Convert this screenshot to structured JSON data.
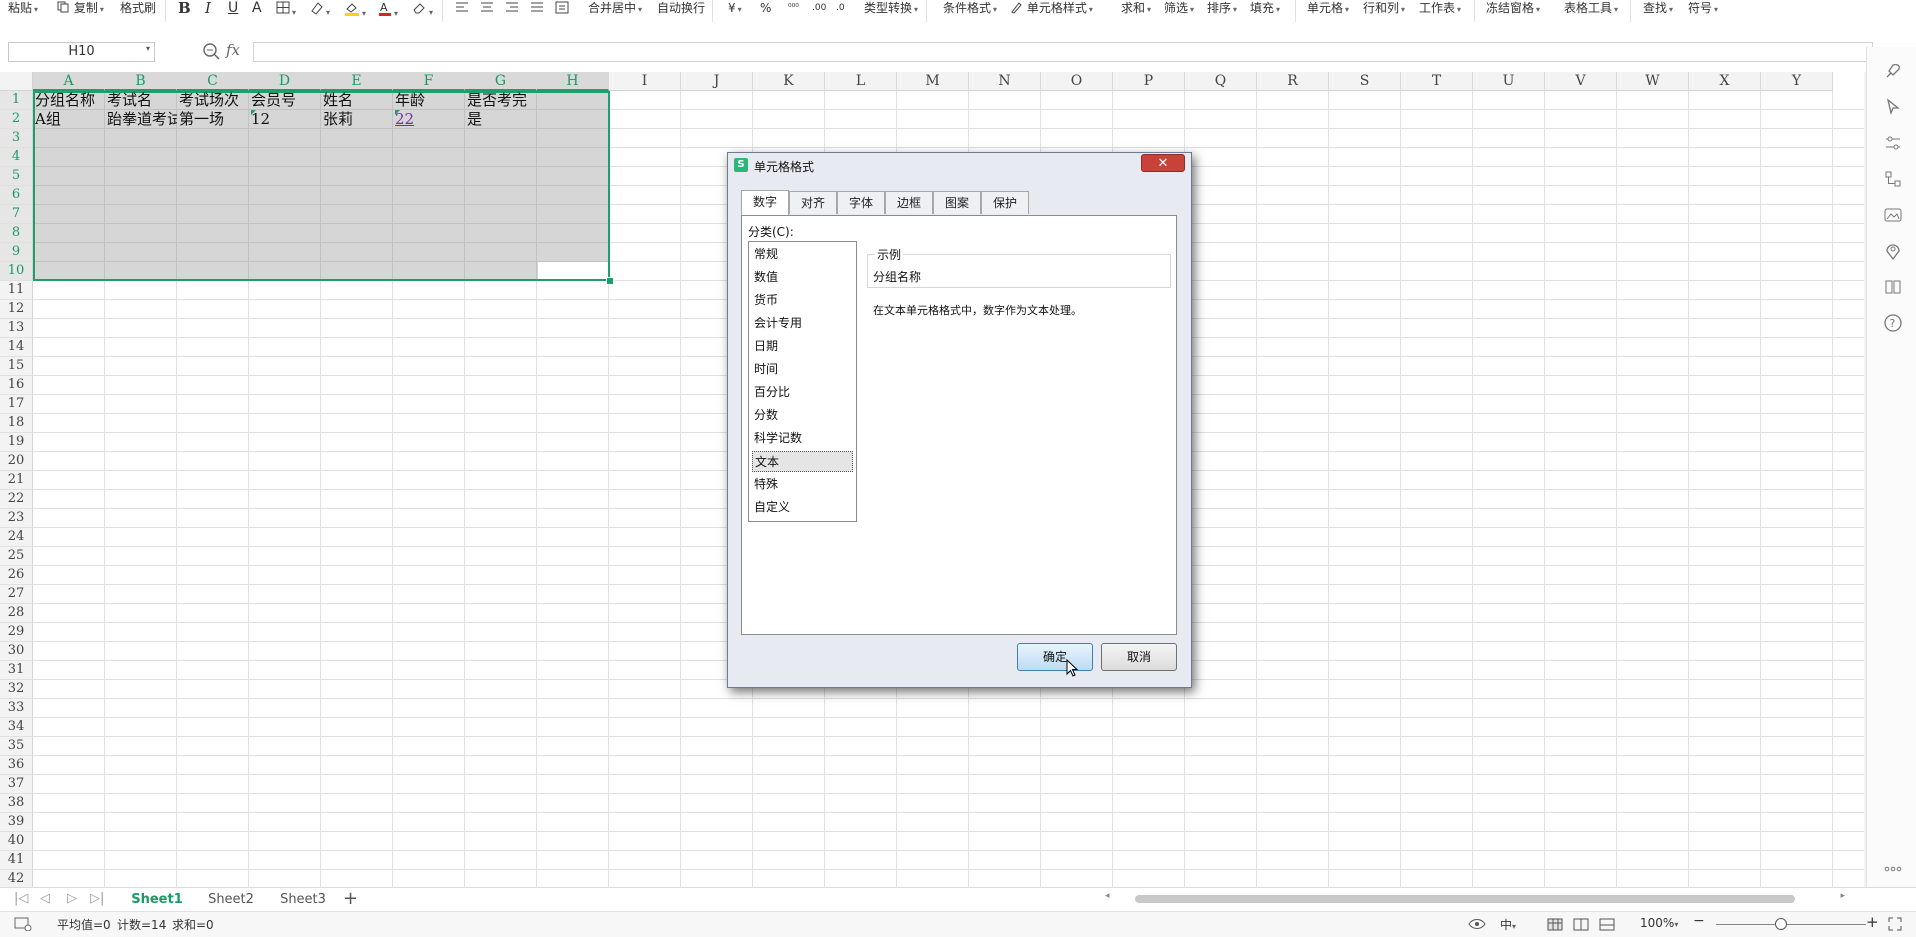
{
  "ribbon": {
    "items": [
      {
        "label": "粘贴",
        "dd": true
      },
      {
        "label": "复制",
        "dd": true
      },
      {
        "label": "格式刷",
        "dd": false
      },
      {
        "label": "合并居中",
        "dd": true
      },
      {
        "label": "自动换行",
        "dd": false
      },
      {
        "label": "类型转换",
        "dd": true
      },
      {
        "label": "条件格式",
        "dd": true
      },
      {
        "label": "单元格样式",
        "dd": true
      },
      {
        "label": "求和",
        "dd": true
      },
      {
        "label": "筛选",
        "dd": true
      },
      {
        "label": "排序",
        "dd": true
      },
      {
        "label": "填充",
        "dd": true
      },
      {
        "label": "单元格",
        "dd": true
      },
      {
        "label": "行和列",
        "dd": true
      },
      {
        "label": "工作表",
        "dd": true
      },
      {
        "label": "冻结窗格",
        "dd": true
      },
      {
        "label": "表格工具",
        "dd": true
      },
      {
        "label": "查找",
        "dd": true
      },
      {
        "label": "符号",
        "dd": true
      }
    ],
    "icons": [
      "bold-icon",
      "italic-icon",
      "underline-icon",
      "font-effect-icon",
      "border-icon",
      "fill-color-icon",
      "font-color-icon",
      "clear-format-icon",
      "align-left-icon",
      "align-center-icon",
      "align-right-icon",
      "justify-icon",
      "indent-icon",
      "currency-icon",
      "percent-icon",
      "thousands-icon",
      "increase-decimal-icon",
      "decrease-decimal-icon"
    ],
    "font_color": "#e02020",
    "fill_color": "#ffd400"
  },
  "formula_bar": {
    "name_box": "H10",
    "fx_label": "fx",
    "formula": ""
  },
  "grid": {
    "columns": [
      "A",
      "B",
      "C",
      "D",
      "E",
      "F",
      "G",
      "H",
      "I",
      "J",
      "K",
      "L",
      "M",
      "N",
      "O",
      "P",
      "Q",
      "R",
      "S",
      "T",
      "U",
      "V",
      "W",
      "X",
      "Y"
    ],
    "rows": [
      "1",
      "2",
      "3",
      "4",
      "5",
      "6",
      "7",
      "8",
      "9",
      "10",
      "11",
      "12",
      "13",
      "14",
      "15",
      "16",
      "17",
      "18",
      "19",
      "20",
      "21",
      "22",
      "23",
      "24",
      "25",
      "26",
      "27",
      "28",
      "29",
      "30",
      "31",
      "32",
      "33",
      "34",
      "35",
      "36",
      "37",
      "38",
      "39",
      "40",
      "41",
      "42"
    ],
    "row1": [
      "分组名称",
      "考试名",
      "考试场次",
      "会员号",
      "姓名",
      "年龄",
      "是否考完"
    ],
    "row2": [
      "A组",
      "跆拳道考试",
      "第一场",
      "12",
      "张莉",
      "22",
      "是"
    ],
    "selection": "A1:H10",
    "accent": "#1f9d6a"
  },
  "sheets": {
    "tabs": [
      "Sheet1",
      "Sheet2",
      "Sheet3"
    ],
    "active": "Sheet1",
    "add": "+"
  },
  "status": {
    "average": "平均值=0",
    "count": "计数=14",
    "sum": "求和=0",
    "lang": "中",
    "zoom": "100%",
    "zoom_value": 100
  },
  "dialog": {
    "title": "单元格格式",
    "close": "✕",
    "tabs": [
      "数字",
      "对齐",
      "字体",
      "边框",
      "图案",
      "保护"
    ],
    "active_tab": "数字",
    "category_label": "分类(C):",
    "categories": [
      "常规",
      "数值",
      "货币",
      "会计专用",
      "日期",
      "时间",
      "百分比",
      "分数",
      "科学记数",
      "文本",
      "特殊",
      "自定义"
    ],
    "selected_category": "文本",
    "sample_label": "示例",
    "sample_value": "分组名称",
    "description": "在文本单元格格式中，数字作为文本处理。",
    "ok": "确定",
    "cancel": "取消"
  }
}
